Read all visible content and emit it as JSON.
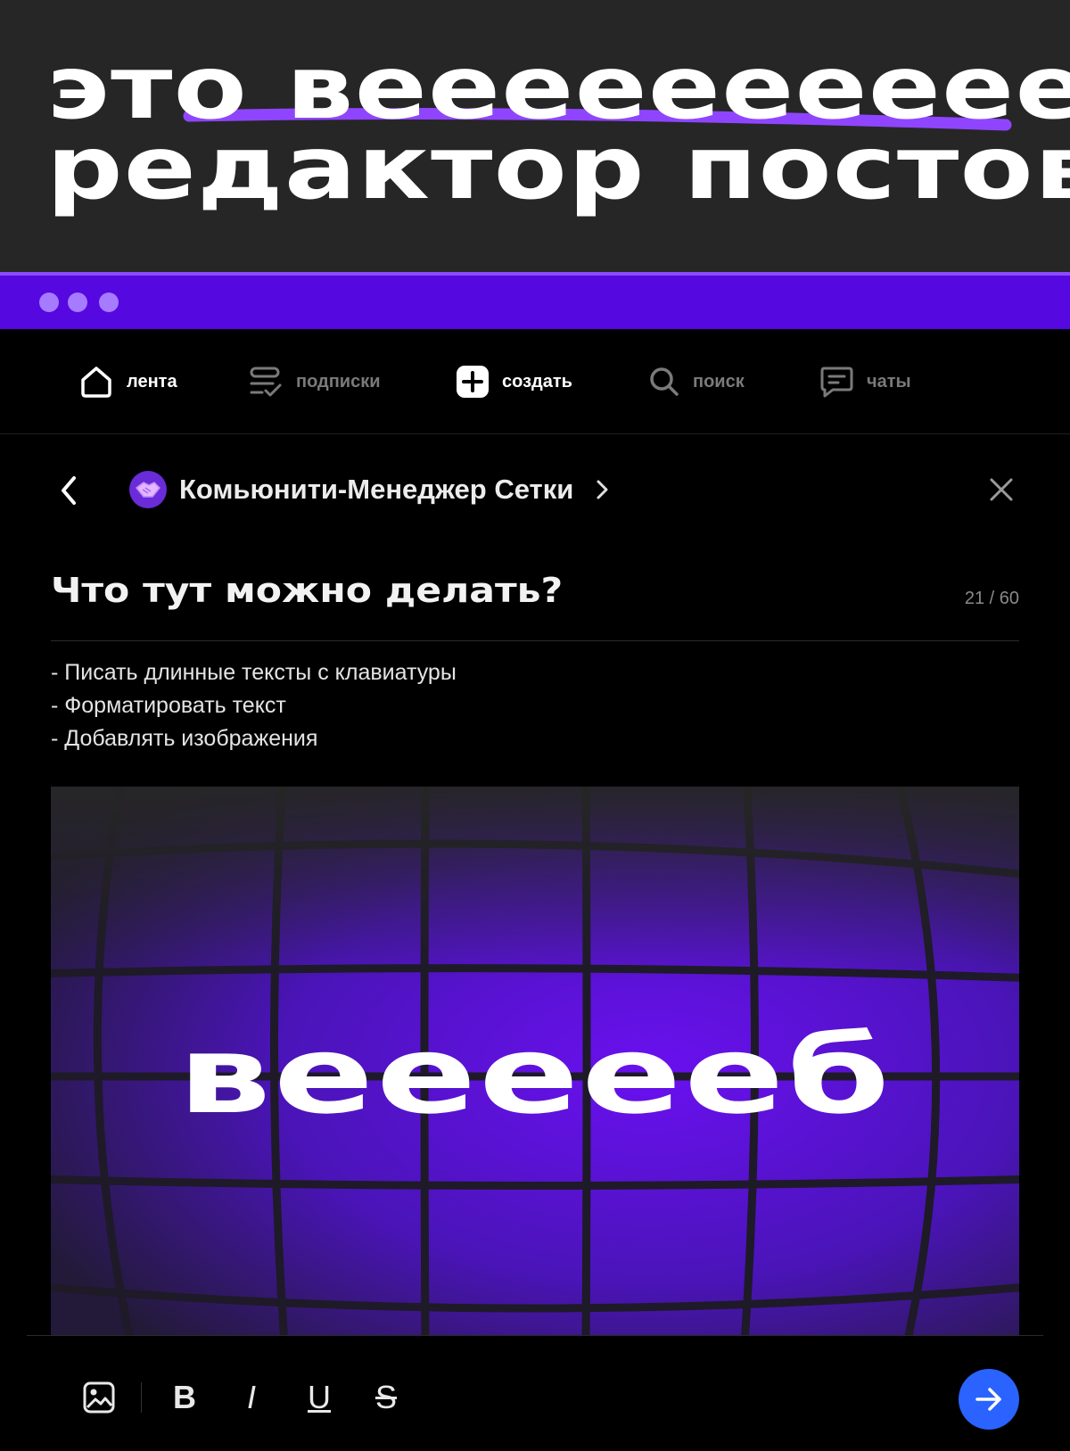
{
  "banner": {
    "line1": "это веееееееееееб-",
    "line2": "редактор постов",
    "accent_color": "#8f45ff"
  },
  "window_bar": {
    "color": "#5508e0",
    "dots": 3
  },
  "nav": {
    "items": [
      {
        "label": "лента",
        "icon": "home-icon",
        "active": true
      },
      {
        "label": "подписки",
        "icon": "subscriptions-icon",
        "active": false
      },
      {
        "label": "создать",
        "icon": "plus-square-icon",
        "active": true
      },
      {
        "label": "поиск",
        "icon": "search-icon",
        "active": false
      },
      {
        "label": "чаты",
        "icon": "chat-icon",
        "active": false
      }
    ]
  },
  "post": {
    "author": "Комьюнити-Менеджер Сетки",
    "title": "Что тут можно делать?",
    "char_count": "21 / 60",
    "body_lines": [
      "- Писать длинные тексты с клавиатуры",
      "- Форматировать текст",
      "- Добавлять изображения"
    ],
    "image_text": "веееееб"
  },
  "toolbar": {
    "tools": [
      "image-icon",
      "bold-icon",
      "italic-icon",
      "underline-icon",
      "strikethrough-icon"
    ],
    "bold_label": "B",
    "italic_label": "I",
    "underline_label": "U",
    "strike_label": "S",
    "send_color": "#2a63ff"
  }
}
